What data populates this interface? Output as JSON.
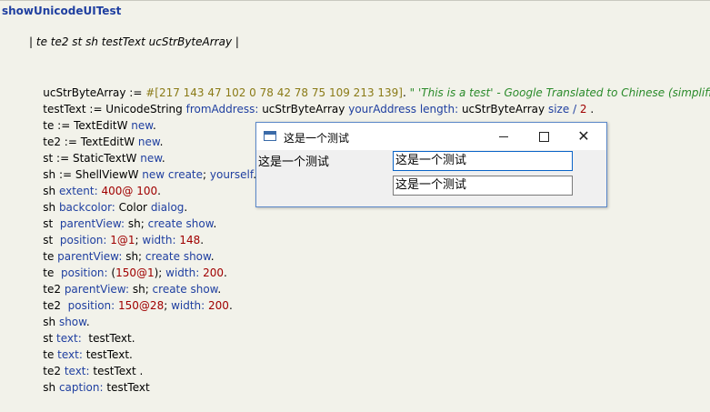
{
  "method": {
    "title": "showUnicodeUITest",
    "temps": "| te te2 st sh testText ucStrByteArray |"
  },
  "code": {
    "l1": {
      "a": "ucStrByteArray := ",
      "b": "#[217 143 47 102 0 78 42 78 75 109 213 139]",
      "c": ". ",
      "d": "\" 'This is a test' - Google Translated to Chinese (simplified).\""
    },
    "l2": {
      "a": "testText := UnicodeString ",
      "b": "fromAddress:",
      "c": " ucStrByteArray ",
      "d": "yourAddress",
      "e": " ",
      "f": "length:",
      "g": " ucStrByteArray ",
      "h": "size",
      "i": " / ",
      "j": "2",
      "k": " ."
    },
    "l3": {
      "a": "te := TextEditW ",
      "b": "new",
      "c": "."
    },
    "l4": {
      "a": "te2 := TextEditW ",
      "b": "new",
      "c": "."
    },
    "l5": {
      "a": "st := StaticTextW ",
      "b": "new",
      "c": "."
    },
    "l6": {
      "a": "sh := ShellViewW ",
      "b": "new",
      "c": " ",
      "d": "create",
      "e": "; ",
      "f": "yourself",
      "g": "."
    },
    "l7": {
      "a": "sh ",
      "b": "extent:",
      "c": " ",
      "d": "400@ 100",
      "e": "."
    },
    "l8": {
      "a": "sh ",
      "b": "backcolor:",
      "c": " Color ",
      "d": "dialog",
      "e": "."
    },
    "l9": {
      "a": "st  ",
      "b": "parentView:",
      "c": " sh; ",
      "d": "create",
      "e": " ",
      "f": "show",
      "g": "."
    },
    "l10": {
      "a": "st  ",
      "b": "position:",
      "c": " ",
      "d": "1@1",
      "e": "; ",
      "f": "width:",
      "g": " ",
      "h": "148",
      "i": "."
    },
    "l11": {
      "a": "te ",
      "b": "parentView:",
      "c": " sh; ",
      "d": "create",
      "e": " ",
      "f": "show",
      "g": "."
    },
    "l12": {
      "a": "te  ",
      "b": "position:",
      "c": " (",
      "d": "150@1",
      "e": "); ",
      "f": "width:",
      "g": " ",
      "h": "200",
      "i": "."
    },
    "l13": {
      "a": "te2 ",
      "b": "parentView:",
      "c": " sh; ",
      "d": "create",
      "e": " ",
      "f": "show",
      "g": "."
    },
    "l14": {
      "a": "te2  ",
      "b": "position:",
      "c": " ",
      "d": "150@28",
      "e": "; ",
      "f": "width:",
      "g": " ",
      "h": "200",
      "i": "."
    },
    "l15": {
      "a": "sh ",
      "b": "show",
      "c": "."
    },
    "l16": {
      "a": "st ",
      "b": "text:",
      "c": "  testText."
    },
    "l17": {
      "a": "te ",
      "b": "text:",
      "c": " testText."
    },
    "l18": {
      "a": "te2 ",
      "b": "text:",
      "c": " testText ."
    },
    "l19": {
      "a": "sh ",
      "b": "caption:",
      "c": " testText"
    }
  },
  "window": {
    "title": "这是一个测试",
    "static_text": "这是一个测试",
    "edit1_value": "这是一个测试",
    "edit2_value": "这是一个测试",
    "close_glyph": "✕"
  },
  "colors": {
    "keyword": "#1f3fa0",
    "number": "#a00000",
    "literal": "#8a7a16",
    "comment": "#2a8a2a",
    "background": "#f2f2ea"
  }
}
